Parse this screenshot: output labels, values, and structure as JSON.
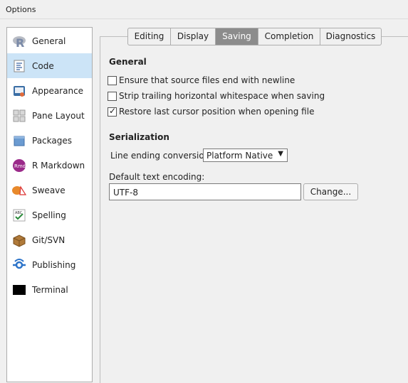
{
  "window": {
    "title": "Options"
  },
  "sidebar": {
    "items": [
      {
        "label": "General",
        "icon": "r-logo-icon"
      },
      {
        "label": "Code",
        "icon": "code-document-icon",
        "selected": true
      },
      {
        "label": "Appearance",
        "icon": "appearance-icon"
      },
      {
        "label": "Pane Layout",
        "icon": "pane-layout-icon"
      },
      {
        "label": "Packages",
        "icon": "packages-icon"
      },
      {
        "label": "R Markdown",
        "icon": "r-markdown-icon"
      },
      {
        "label": "Sweave",
        "icon": "sweave-icon"
      },
      {
        "label": "Spelling",
        "icon": "spelling-icon"
      },
      {
        "label": "Git/SVN",
        "icon": "git-svn-icon"
      },
      {
        "label": "Publishing",
        "icon": "publishing-icon"
      },
      {
        "label": "Terminal",
        "icon": "terminal-icon"
      }
    ]
  },
  "tabs": [
    {
      "label": "Editing"
    },
    {
      "label": "Display"
    },
    {
      "label": "Saving",
      "active": true
    },
    {
      "label": "Completion"
    },
    {
      "label": "Diagnostics"
    }
  ],
  "general": {
    "heading": "General",
    "options": [
      {
        "label": "Ensure that source files end with newline",
        "checked": false
      },
      {
        "label": "Strip trailing horizontal whitespace when saving",
        "checked": false
      },
      {
        "label": "Restore last cursor position when opening file",
        "checked": true
      }
    ]
  },
  "serialization": {
    "heading": "Serialization",
    "line_ending_label": "Line ending conversion:",
    "line_ending_value": "Platform Native",
    "encoding_label": "Default text encoding:",
    "encoding_value": "UTF-8",
    "change_label": "Change..."
  },
  "icons": {
    "check": "✓",
    "dropdown_arrow": "▼"
  },
  "colors": {
    "selected_row": "#cce4f7",
    "active_tab": "#8c8c8c"
  }
}
